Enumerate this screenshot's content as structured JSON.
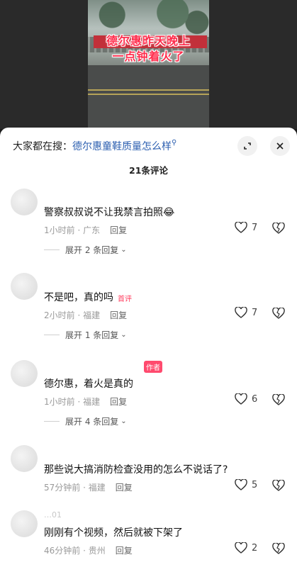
{
  "video": {
    "caption_line1": "德尔惠昨天晚上",
    "caption_line2": "一点钟着火了"
  },
  "sheet": {
    "search_prefix": "大家都在搜：",
    "search_link": "德尔惠童鞋质量怎么样",
    "comment_count": "21条评论"
  },
  "comments": [
    {
      "text": "警察叔叔说不让我禁言拍照",
      "emoji": "😂",
      "time": "1小时前 · 广东",
      "reply": "回复",
      "likes": "7",
      "expand": "展开 2 条回复"
    },
    {
      "text": "不是吧，真的吗",
      "first_tag": "首评",
      "time": "2小时前 · 福建",
      "reply": "回复",
      "likes": "7",
      "expand": "展开 1 条回复"
    },
    {
      "author_tag": "作者",
      "text": "德尔惠，着火是真的",
      "time": "1小时前 · 福建",
      "reply": "回复",
      "likes": "6",
      "expand": "展开 4 条回复"
    },
    {
      "text": "那些说大搞消防检查没用的怎么不说话了?",
      "time": "57分钟前 · 福建",
      "reply": "回复",
      "likes": "5"
    },
    {
      "username": "…01",
      "text": "刚刚有个视频，然后就被下架了",
      "time": "46分钟前 · 贵州",
      "reply": "回复",
      "likes": "2"
    }
  ],
  "colors": {
    "accent_link": "#2c5fb0",
    "caption_red": "#ff2e4d",
    "first_tag": "#ff3b5c"
  }
}
